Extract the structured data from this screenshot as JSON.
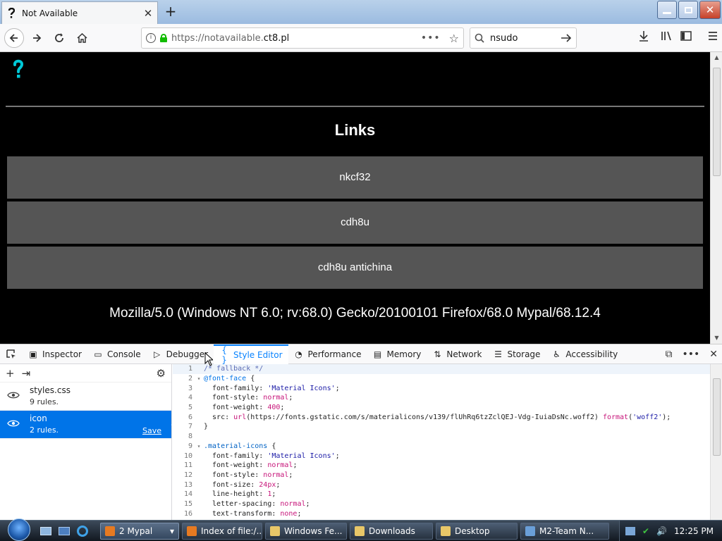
{
  "browser": {
    "tab_title": "Not Available",
    "url_prefix": "https://notavailable.",
    "url_domain": "ct8.pl",
    "search_value": "nsudo"
  },
  "page": {
    "heading": "Links",
    "links": [
      "nkcf32",
      "cdh8u",
      "cdh8u antichina"
    ],
    "user_agent": "Mozilla/5.0 (Windows NT 6.0; rv:68.0) Gecko/20100101 Firefox/68.0 Mypal/68.12.4",
    "logo_color": "#00c8d7"
  },
  "devtools": {
    "tabs": [
      {
        "label": "Inspector",
        "icon": "inspector-icon"
      },
      {
        "label": "Console",
        "icon": "console-icon"
      },
      {
        "label": "Debugger",
        "icon": "debugger-icon"
      },
      {
        "label": "Style Editor",
        "icon": "style-editor-icon",
        "active": true
      },
      {
        "label": "Performance",
        "icon": "performance-icon"
      },
      {
        "label": "Memory",
        "icon": "memory-icon"
      },
      {
        "label": "Network",
        "icon": "network-icon"
      },
      {
        "label": "Storage",
        "icon": "storage-icon"
      },
      {
        "label": "Accessibility",
        "icon": "accessibility-icon"
      }
    ],
    "stylesheets": [
      {
        "name": "styles.css",
        "rules": "9 rules."
      },
      {
        "name": "icon",
        "rules": "2 rules.",
        "save_label": "Save",
        "selected": true
      }
    ],
    "code_lines": [
      "/* fallback */",
      "@font-face {",
      "  font-family: 'Material Icons';",
      "  font-style: normal;",
      "  font-weight: 400;",
      "  src: url(https://fonts.gstatic.com/s/materialicons/v139/flUhRq6tzZclQEJ-Vdg-IuiaDsNc.woff2) format('woff2');",
      "}",
      "",
      ".material-icons {",
      "  font-family: 'Material Icons';",
      "  font-weight: normal;",
      "  font-style: normal;",
      "  font-size: 24px;",
      "  line-height: 1;",
      "  letter-spacing: normal;",
      "  text-transform: none;"
    ]
  },
  "taskbar": {
    "tasks": [
      {
        "label": "2 Mypal",
        "icon": "firefox-group-icon",
        "active": true
      },
      {
        "label": "Index of file:/...",
        "icon": "firefox-icon"
      },
      {
        "label": "Windows Fe...",
        "icon": "folder-icon"
      },
      {
        "label": "Downloads",
        "icon": "folder-icon"
      },
      {
        "label": "Desktop",
        "icon": "folder-icon"
      },
      {
        "label": "M2-Team N...",
        "icon": "window-icon"
      }
    ],
    "clock": "12:25 PM"
  }
}
